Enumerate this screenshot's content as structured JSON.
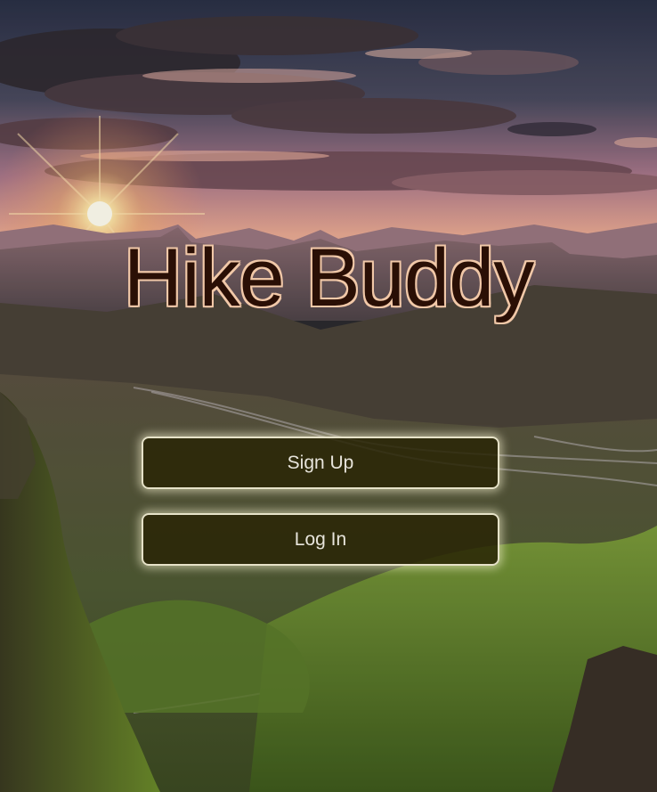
{
  "app": {
    "title": "Hike Buddy"
  },
  "actions": {
    "sign_up_label": "Sign Up",
    "log_in_label": "Log In"
  },
  "colors": {
    "title_fill": "#2a0f05",
    "title_outline": "#f1c8a8",
    "button_bg": "#2a2506",
    "button_border": "#e6e2c8",
    "button_text": "#e8e5dc"
  }
}
